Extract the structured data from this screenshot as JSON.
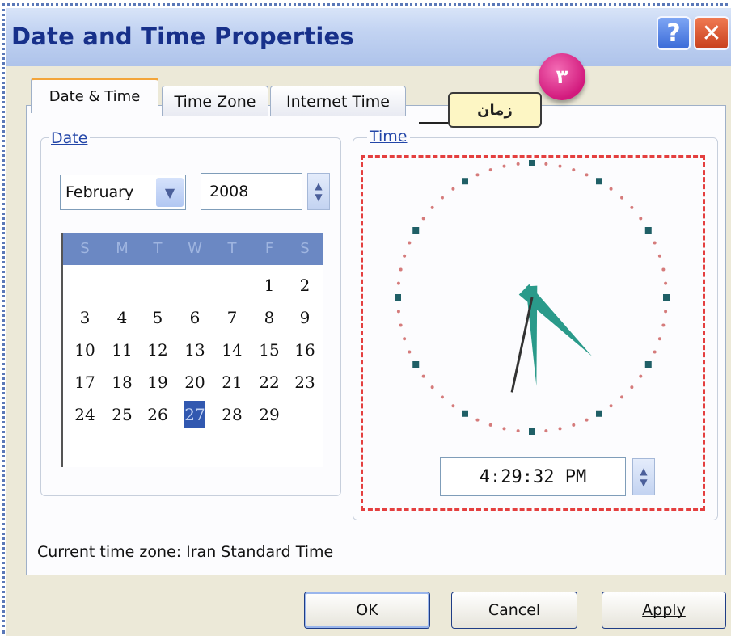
{
  "window": {
    "title": "Date and Time Properties",
    "help_glyph": "?",
    "close_glyph": "✕"
  },
  "annotation": {
    "badge_number": "۳",
    "callout_text": "زمان"
  },
  "tabs": [
    {
      "label": "Date & Time",
      "active": true
    },
    {
      "label": "Time Zone",
      "active": false
    },
    {
      "label": "Internet Time",
      "active": false
    }
  ],
  "date_group": {
    "label": "Date",
    "month": "February",
    "year": "2008",
    "day_names": [
      "S",
      "M",
      "T",
      "W",
      "T",
      "F",
      "S"
    ],
    "weeks": [
      [
        "",
        "",
        "",
        "",
        "",
        "1",
        "2"
      ],
      [
        "3",
        "4",
        "5",
        "6",
        "7",
        "8",
        "9"
      ],
      [
        "10",
        "11",
        "12",
        "13",
        "14",
        "15",
        "16"
      ],
      [
        "17",
        "18",
        "19",
        "20",
        "21",
        "22",
        "23"
      ],
      [
        "24",
        "25",
        "26",
        "27",
        "28",
        "29",
        ""
      ]
    ],
    "selected_day": "27"
  },
  "time_group": {
    "label": "Time",
    "time_value": "4:29:32 PM",
    "clock": {
      "hour": 4,
      "minute": 29,
      "second": 32
    }
  },
  "status": {
    "time_zone_text": "Current time zone: Iran Standard Time"
  },
  "buttons": {
    "ok": "OK",
    "cancel": "Cancel",
    "apply": "Apply"
  },
  "colors": {
    "title_text": "#17308a",
    "clock_hands": "#2a9a8a",
    "dashed_highlight": "#e43f3f",
    "badge": "#d21a7d"
  }
}
